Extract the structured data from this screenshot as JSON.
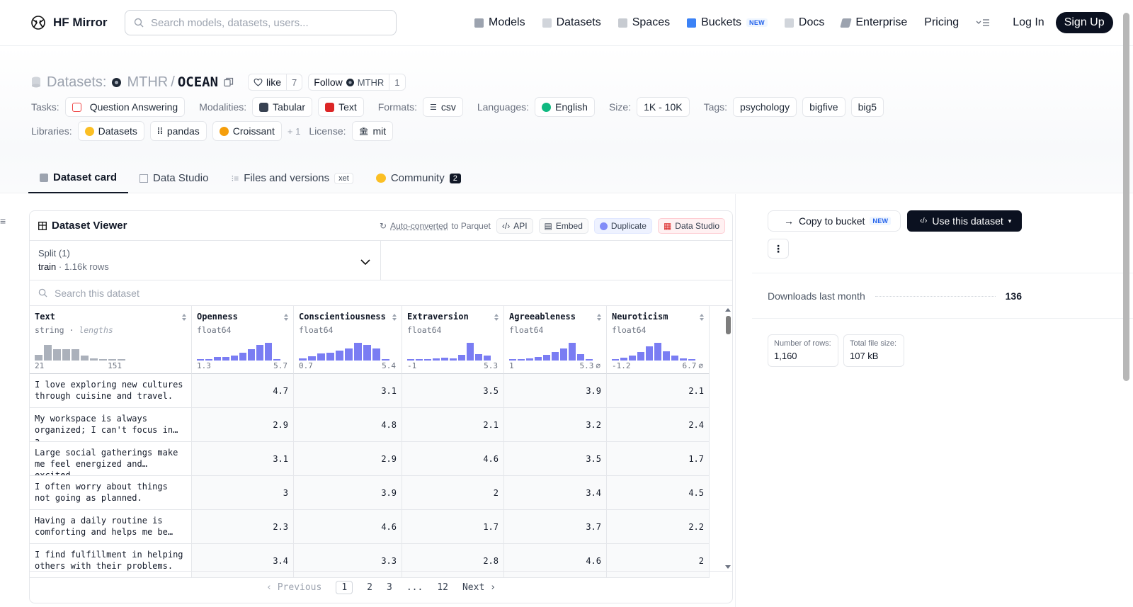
{
  "nav": {
    "brand": "HF Mirror",
    "search_placeholder": "Search models, datasets, users...",
    "links": [
      "Models",
      "Datasets",
      "Spaces",
      "Buckets",
      "Docs",
      "Enterprise",
      "Pricing"
    ],
    "buckets_badge": "NEW",
    "login": "Log In",
    "signup": "Sign Up"
  },
  "header": {
    "section": "Datasets:",
    "owner": "MTHR",
    "separator": "/",
    "name": "OCEAN",
    "like_label": "like",
    "like_count": "7",
    "follow_label": "Follow",
    "follow_owner": "MTHR",
    "follow_count": "1"
  },
  "meta": {
    "tasks_label": "Tasks:",
    "task": "Question Answering",
    "modalities_label": "Modalities:",
    "modality_1": "Tabular",
    "modality_2": "Text",
    "formats_label": "Formats:",
    "format": "csv",
    "languages_label": "Languages:",
    "language": "English",
    "size_label": "Size:",
    "size": "1K - 10K",
    "tags_label": "Tags:",
    "tags": [
      "psychology",
      "bigfive",
      "big5"
    ],
    "libraries_label": "Libraries:",
    "libraries": [
      "Datasets",
      "pandas",
      "Croissant"
    ],
    "libraries_more": "+ 1",
    "license_label": "License:",
    "license": "mit"
  },
  "tabs": {
    "card": "Dataset card",
    "studio": "Data Studio",
    "files": "Files and versions",
    "files_badge": "xet",
    "community": "Community",
    "community_count": "2"
  },
  "viewer": {
    "title": "Dataset Viewer",
    "auto_converted": "Auto-converted",
    "to_parquet": "to Parquet",
    "api": "API",
    "embed": "Embed",
    "duplicate": "Duplicate",
    "data_studio": "Data Studio",
    "split_label": "Split (1)",
    "split_name": "train",
    "split_sep": "·",
    "split_rows": "1.16k rows",
    "search_placeholder": "Search this dataset",
    "columns": [
      {
        "name": "Text",
        "type": "string",
        "extra": "lengths",
        "min": "21",
        "max": "151",
        "hist": [
          0.3,
          0.85,
          0.6,
          0.6,
          0.6,
          0.25,
          0.12,
          0.05,
          0.05,
          0.05
        ]
      },
      {
        "name": "Openness",
        "type": "float64",
        "min": "1.3",
        "max": "5.7",
        "hist": [
          0.05,
          0.08,
          0.18,
          0.2,
          0.28,
          0.42,
          0.62,
          0.85,
          0.95,
          0.05
        ]
      },
      {
        "name": "Conscientiousness",
        "type": "float64",
        "min": "0.7",
        "max": "5.4",
        "hist": [
          0.1,
          0.22,
          0.38,
          0.42,
          0.52,
          0.65,
          0.95,
          0.85,
          0.65,
          0.08
        ]
      },
      {
        "name": "Extraversion",
        "type": "float64",
        "min": "-1",
        "max": "5.3",
        "hist": [
          0.04,
          0.04,
          0.06,
          0.1,
          0.14,
          0.12,
          0.3,
          0.95,
          0.35,
          0.25
        ]
      },
      {
        "name": "Agreeableness",
        "type": "float64",
        "min": "1",
        "max": "5.3",
        "hist": [
          0.05,
          0.05,
          0.1,
          0.18,
          0.3,
          0.45,
          0.65,
          0.95,
          0.35,
          0.06
        ]
      },
      {
        "name": "Neuroticism",
        "type": "float64",
        "min": "-1.2",
        "max": "6.7",
        "hist": [
          0.05,
          0.15,
          0.25,
          0.45,
          0.75,
          0.95,
          0.5,
          0.25,
          0.12,
          0.04
        ]
      }
    ],
    "null_mark": "∅",
    "rows": [
      [
        "I love exploring new cultures through cuisine and travel.",
        "4.7",
        "3.1",
        "3.5",
        "3.9",
        "2.1"
      ],
      [
        "My workspace is always organized; I can't focus in a…",
        "2.9",
        "4.8",
        "2.1",
        "3.2",
        "2.4"
      ],
      [
        "Large social gatherings make me feel energized and excited.",
        "3.1",
        "2.9",
        "4.6",
        "3.5",
        "1.7"
      ],
      [
        "I often worry about things not going as planned.",
        "3",
        "3.9",
        "2",
        "3.4",
        "4.5"
      ],
      [
        "Having a daily routine is comforting and helps me be…",
        "2.3",
        "4.6",
        "1.7",
        "3.7",
        "2.2"
      ],
      [
        "I find fulfillment in helping others with their problems.",
        "3.4",
        "3.3",
        "2.8",
        "4.6",
        "2"
      ]
    ],
    "pager": {
      "prev": "Previous",
      "pages": [
        "1",
        "2",
        "3",
        "...",
        "12"
      ],
      "next": "Next"
    }
  },
  "side": {
    "copy": "Copy to bucket",
    "copy_badge": "NEW",
    "use": "Use this dataset",
    "downloads_label": "Downloads last month",
    "downloads": "136",
    "rows_label": "Number of rows:",
    "rows": "1,160",
    "size_label": "Total file size:",
    "size": "107 kB"
  },
  "colors": {
    "accent": "#6366f1",
    "dark": "#0b1120"
  }
}
